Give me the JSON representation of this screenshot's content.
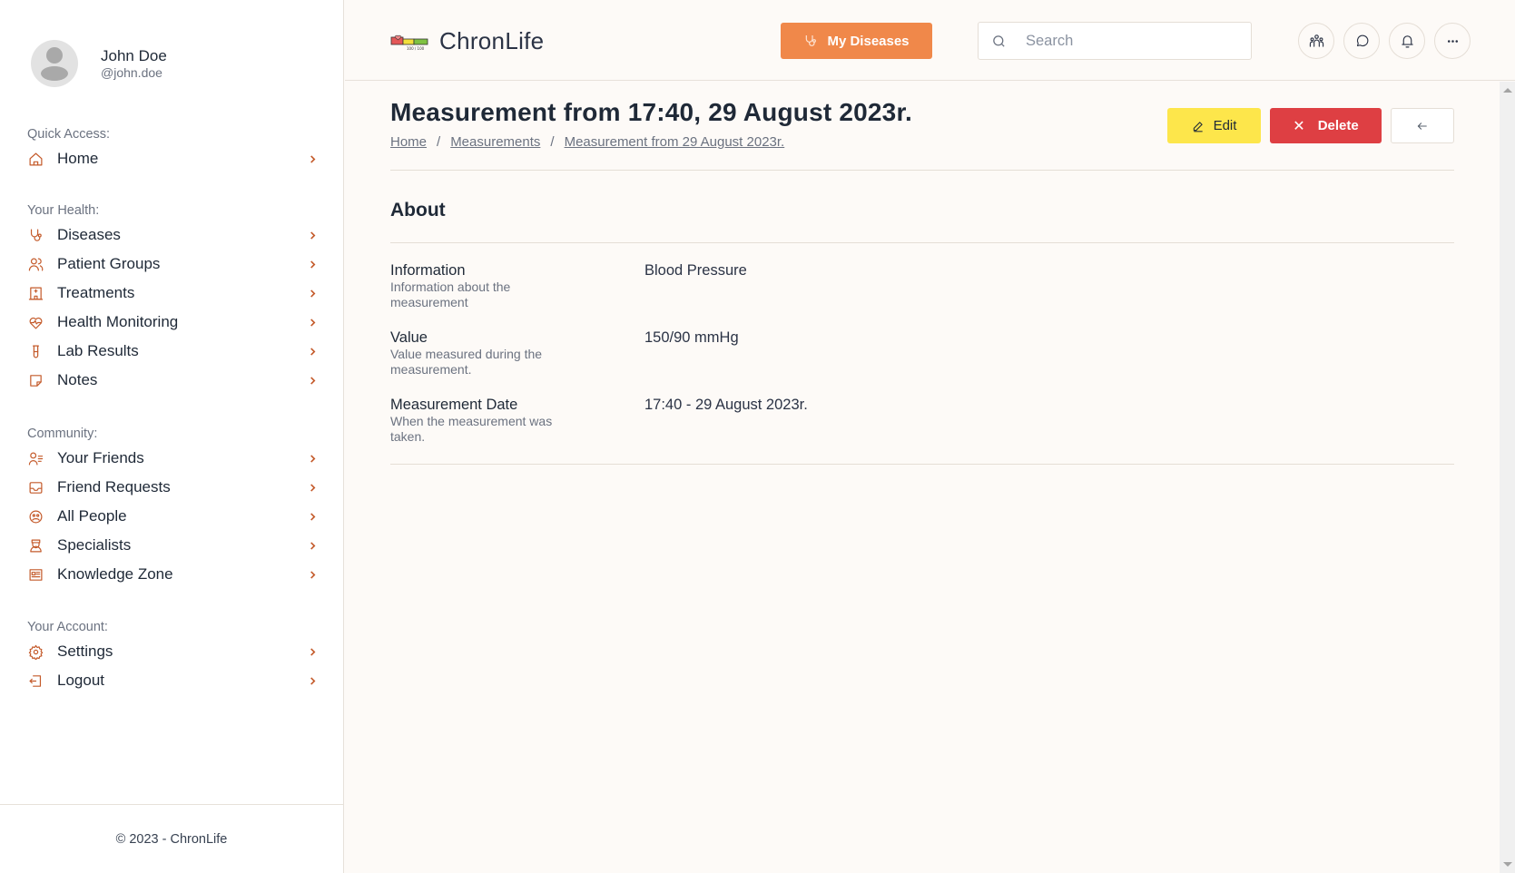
{
  "user": {
    "name": "John Doe",
    "handle": "@john.doe"
  },
  "sidebar": {
    "sections": [
      {
        "heading": "Quick Access:",
        "items": [
          {
            "label": "Home",
            "icon": "home-icon"
          }
        ]
      },
      {
        "heading": "Your Health:",
        "items": [
          {
            "label": "Diseases",
            "icon": "stethoscope-icon"
          },
          {
            "label": "Patient Groups",
            "icon": "users-icon"
          },
          {
            "label": "Treatments",
            "icon": "hospital-icon"
          },
          {
            "label": "Health Monitoring",
            "icon": "heart-pulse-icon"
          },
          {
            "label": "Lab Results",
            "icon": "test-tube-icon"
          },
          {
            "label": "Notes",
            "icon": "note-icon"
          }
        ]
      },
      {
        "heading": "Community:",
        "items": [
          {
            "label": "Your Friends",
            "icon": "user-list-icon"
          },
          {
            "label": "Friend Requests",
            "icon": "inbox-icon"
          },
          {
            "label": "All People",
            "icon": "people-circle-icon"
          },
          {
            "label": "Specialists",
            "icon": "doctor-icon"
          },
          {
            "label": "Knowledge Zone",
            "icon": "newspaper-icon"
          }
        ]
      },
      {
        "heading": "Your Account:",
        "items": [
          {
            "label": "Settings",
            "icon": "gear-icon"
          },
          {
            "label": "Logout",
            "icon": "logout-icon"
          }
        ]
      }
    ],
    "footer": "© 2023 - ChronLife"
  },
  "header": {
    "app_name": "ChronLife",
    "logo_caption": "100 / 100",
    "my_diseases_label": "My Diseases",
    "search_placeholder": "Search",
    "search_value": "",
    "icon_buttons": [
      "groups-icon",
      "chat-icon",
      "bell-icon",
      "more-icon"
    ]
  },
  "page": {
    "title": "Measurement from 17:40, 29 August 2023r.",
    "breadcrumb": [
      "Home",
      "Measurements",
      "Measurement from 29 August 2023r."
    ],
    "actions": {
      "edit": "Edit",
      "delete": "Delete"
    },
    "section_title": "About",
    "fields": [
      {
        "label": "Information",
        "description": "Information about the measurement",
        "value": "Blood Pressure"
      },
      {
        "label": "Value",
        "description": "Value measured during the measurement.",
        "value": "150/90 mmHg"
      },
      {
        "label": "Measurement Date",
        "description": "When the measurement was taken.",
        "value": "17:40 - 29 August 2023r."
      }
    ]
  },
  "colors": {
    "accent": "#f0884a",
    "icon": "#c45a2a",
    "edit": "#fde64b",
    "delete": "#de3f43",
    "background": "#fdfaf7"
  }
}
